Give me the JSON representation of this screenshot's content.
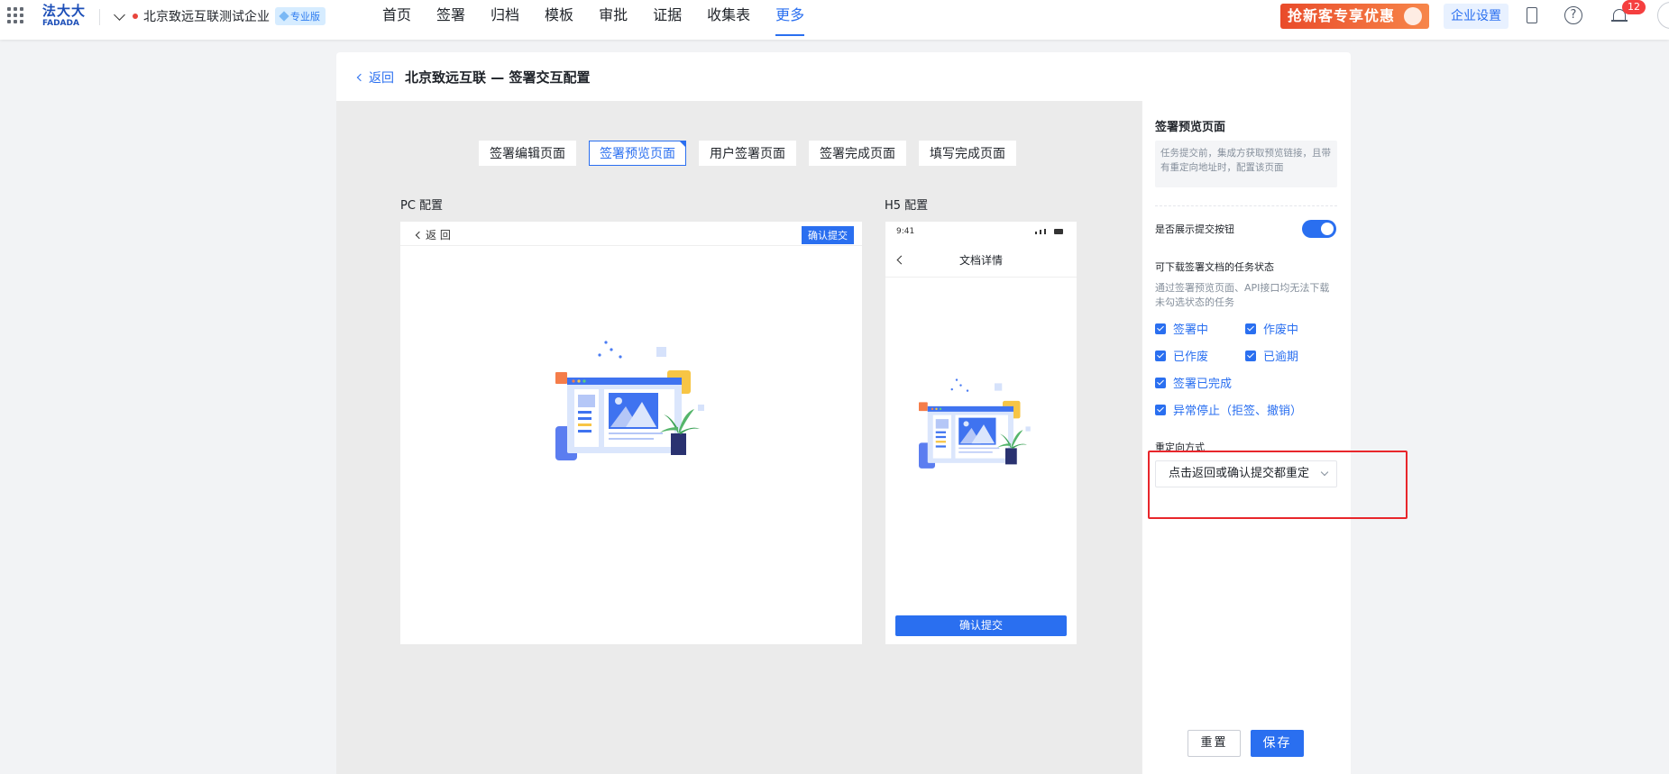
{
  "topbar": {
    "logo_cn": "法大大",
    "logo_en": "FADADA",
    "company_name": "北京致远互联测试企业",
    "plan_badge": "专业版",
    "nav": [
      {
        "label": "首页"
      },
      {
        "label": "签署"
      },
      {
        "label": "归档"
      },
      {
        "label": "模板"
      },
      {
        "label": "审批"
      },
      {
        "label": "证据"
      },
      {
        "label": "收集表"
      },
      {
        "label": "更多",
        "active": true
      }
    ],
    "promo_label": "抢新客专享优惠",
    "enterprise_settings": "企业设置",
    "notification_count": "12"
  },
  "page": {
    "back_label": "返回",
    "title": "北京致远互联 — 签署交互配置"
  },
  "tabs": [
    {
      "label": "签署编辑页面"
    },
    {
      "label": "签署预览页面",
      "active": true
    },
    {
      "label": "用户签署页面"
    },
    {
      "label": "签署完成页面"
    },
    {
      "label": "填写完成页面"
    }
  ],
  "preview": {
    "pc_label": "PC 配置",
    "h5_label": "H5 配置",
    "pc_back": "返 回",
    "pc_confirm": "确认提交",
    "h5_time": "9:41",
    "h5_title": "文档详情",
    "h5_confirm": "确认提交"
  },
  "settings": {
    "section_title": "签署预览页面",
    "section_tip": "任务提交前，集成方获取预览链接，且带有重定向地址时，配置该页面",
    "show_submit_label": "是否展示提交按钮",
    "show_submit_on": true,
    "download_title": "可下载签署文档的任务状态",
    "download_tip": "通过签署预览页面、API接口均无法下载未勾选状态的任务",
    "statuses": [
      {
        "label": "签署中",
        "checked": true
      },
      {
        "label": "作废中",
        "checked": true
      },
      {
        "label": "已作废",
        "checked": true
      },
      {
        "label": "已逾期",
        "checked": true
      },
      {
        "label": "签署已完成",
        "checked": true
      },
      {
        "label": "异常停止（拒签、撤销）",
        "checked": true
      }
    ],
    "redirect_label": "重定向方式",
    "redirect_value": "点击返回或确认提交都重定",
    "reset_label": "重置",
    "save_label": "保存"
  },
  "colors": {
    "accent": "#2a6ff0",
    "highlight": "#e8262b",
    "canvas_bg": "#ebebeb"
  }
}
